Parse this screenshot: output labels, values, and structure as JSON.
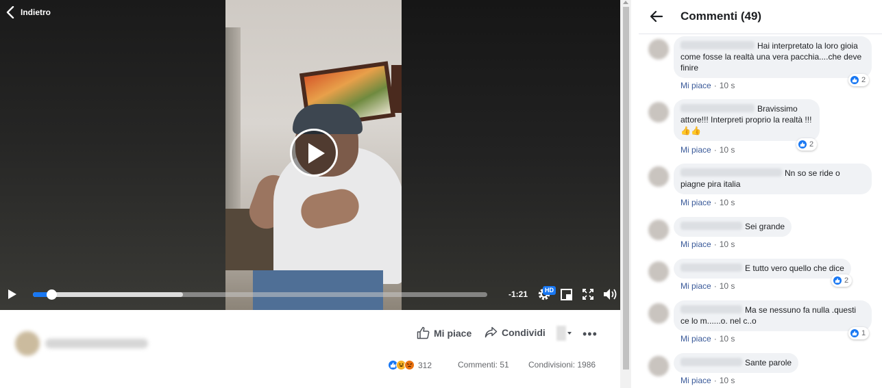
{
  "player": {
    "back_label": "Indietro",
    "time_remaining": "-1:21",
    "hd_badge": "HD",
    "progress_played": 0.04,
    "progress_buffered": 0.33
  },
  "actions": {
    "like_label": "Mi piace",
    "share_label": "Condividi"
  },
  "stats": {
    "reactions_count": "312",
    "comments": "Commenti: 51",
    "shares": "Condivisioni: 1986"
  },
  "panel": {
    "title": "Commenti (49)"
  },
  "comments": [
    {
      "text": "Hai interpretato la loro gioia come fosse la realtà una vera pacchia....che deve finire",
      "like": "Mi piace",
      "time": "10 s",
      "reactions": "2"
    },
    {
      "text": "Bravissimo attore!!! Interpreti proprio la realtà !!! 👍👍",
      "like": "Mi piace",
      "time": "10 s",
      "reactions": "2"
    },
    {
      "text": "Nn so se ride o piagne pira italia",
      "like": "Mi piace",
      "time": "10 s",
      "reactions": ""
    },
    {
      "text": "Sei grande",
      "like": "Mi piace",
      "time": "10 s",
      "reactions": ""
    },
    {
      "text": "E tutto vero quello che dice",
      "like": "Mi piace",
      "time": "10 s",
      "reactions": "2"
    },
    {
      "text": "Ma se nessuno fa nulla .questi ce lo m......o. nel c..o",
      "like": "Mi piace",
      "time": "10 s",
      "reactions": "1"
    },
    {
      "text": "Sante parole",
      "like": "Mi piace",
      "time": "10 s",
      "reactions": ""
    }
  ],
  "colors": {
    "accent": "#1877f2",
    "link": "#385898",
    "bubble": "#f0f2f5"
  }
}
